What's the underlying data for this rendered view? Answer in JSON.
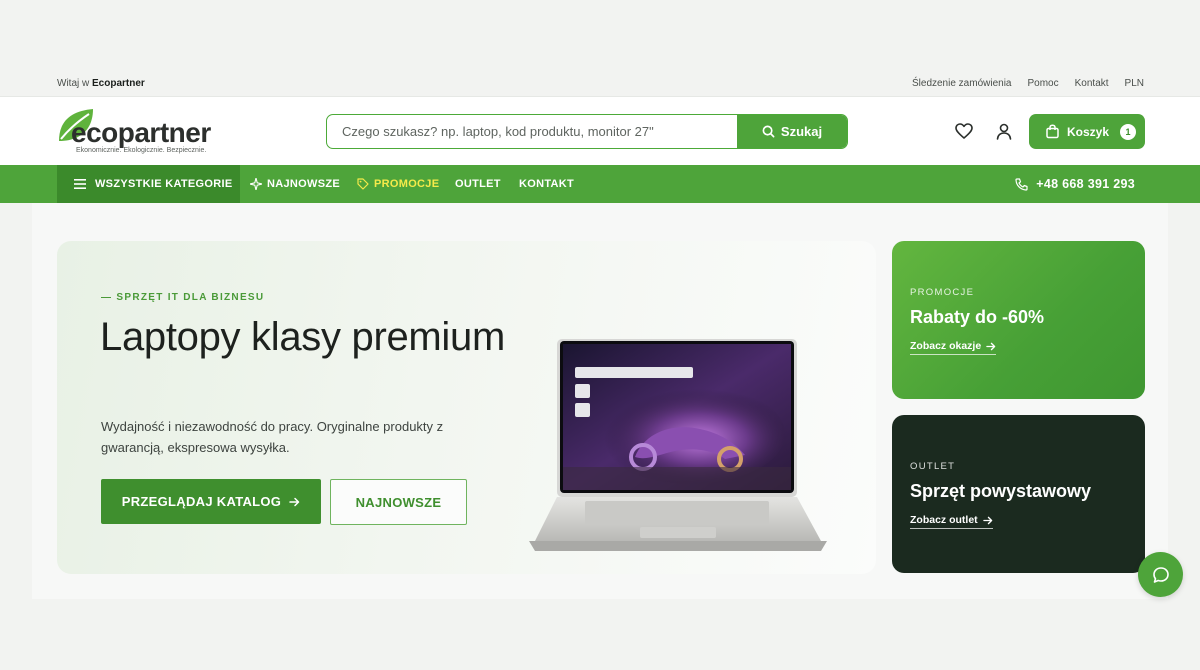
{
  "topbar": {
    "welcome_prefix": "Witaj w",
    "welcome_brand": "Ecopartner",
    "links": [
      "Śledzenie zamówienia",
      "Pomoc",
      "Kontakt",
      "PLN"
    ]
  },
  "header": {
    "logo_text": "ecopartner",
    "logo_tagline": "Ekonomicznie. Ekologicznie. Bezpiecznie.",
    "search_placeholder": "Czego szukasz? np. laptop, kod produktu, monitor 27\"",
    "search_button": "Szukaj",
    "cart_label": "Koszyk",
    "cart_count": "1"
  },
  "nav": {
    "all_categories": "WSZYSTKIE KATEGORIE",
    "newest": "NAJNOWSZE",
    "promotions": "PROMOCJE",
    "outlet": "OUTLET",
    "contact": "KONTAKT",
    "phone": "+48 668 391 293"
  },
  "hero": {
    "eyebrow": "— SPRZĘT IT DLA BIZNESU",
    "title": "Laptopy klasy premium",
    "description": "Wydajność i niezawodność do pracy. Oryginalne produkty z gwarancją, ekspresowa wysyłka.",
    "primary_button": "PRZEGLĄDAJ KATALOG",
    "secondary_button": "NAJNOWSZE"
  },
  "promo_card": {
    "eyebrow": "PROMOCJE",
    "title": "Rabaty do -60%",
    "link": "Zobacz okazje"
  },
  "outlet_card": {
    "eyebrow": "OUTLET",
    "title": "Sprzęt powystawowy",
    "link": "Zobacz outlet"
  },
  "colors": {
    "brand_green": "#4ea43a",
    "dark_green": "#3b8a2b",
    "promo_yellow": "#f5ea4a",
    "outlet_dark": "#1b2a1f"
  },
  "icons": [
    "menu-icon",
    "sparkle-icon",
    "tag-icon",
    "phone-icon",
    "search-icon",
    "heart-icon",
    "user-icon",
    "cart-icon",
    "arrow-right-icon",
    "chat-icon"
  ]
}
